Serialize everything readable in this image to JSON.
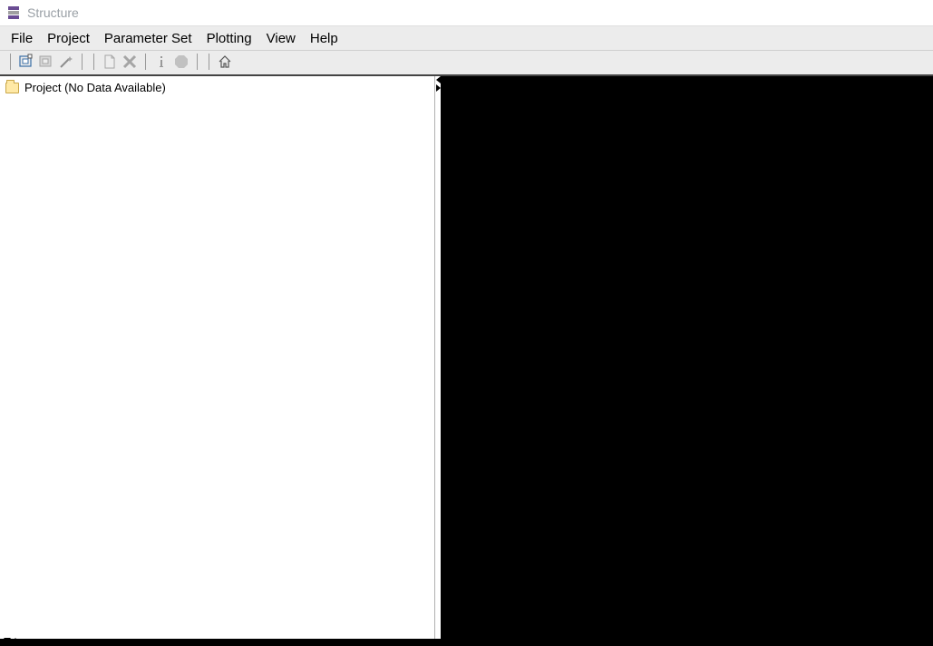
{
  "titlebar": {
    "title": "Structure"
  },
  "menus": {
    "file": "File",
    "project": "Project",
    "parameter_set": "Parameter Set",
    "plotting": "Plotting",
    "view": "View",
    "help": "Help"
  },
  "toolbar": {
    "new_project": "new-project",
    "open_project": "open-project",
    "wizard": "wizard",
    "new_run": "new-run",
    "cancel_run": "cancel-run",
    "info": "info",
    "stop": "stop",
    "home": "home"
  },
  "tree": {
    "root_label": "Project (No Data Available)"
  }
}
